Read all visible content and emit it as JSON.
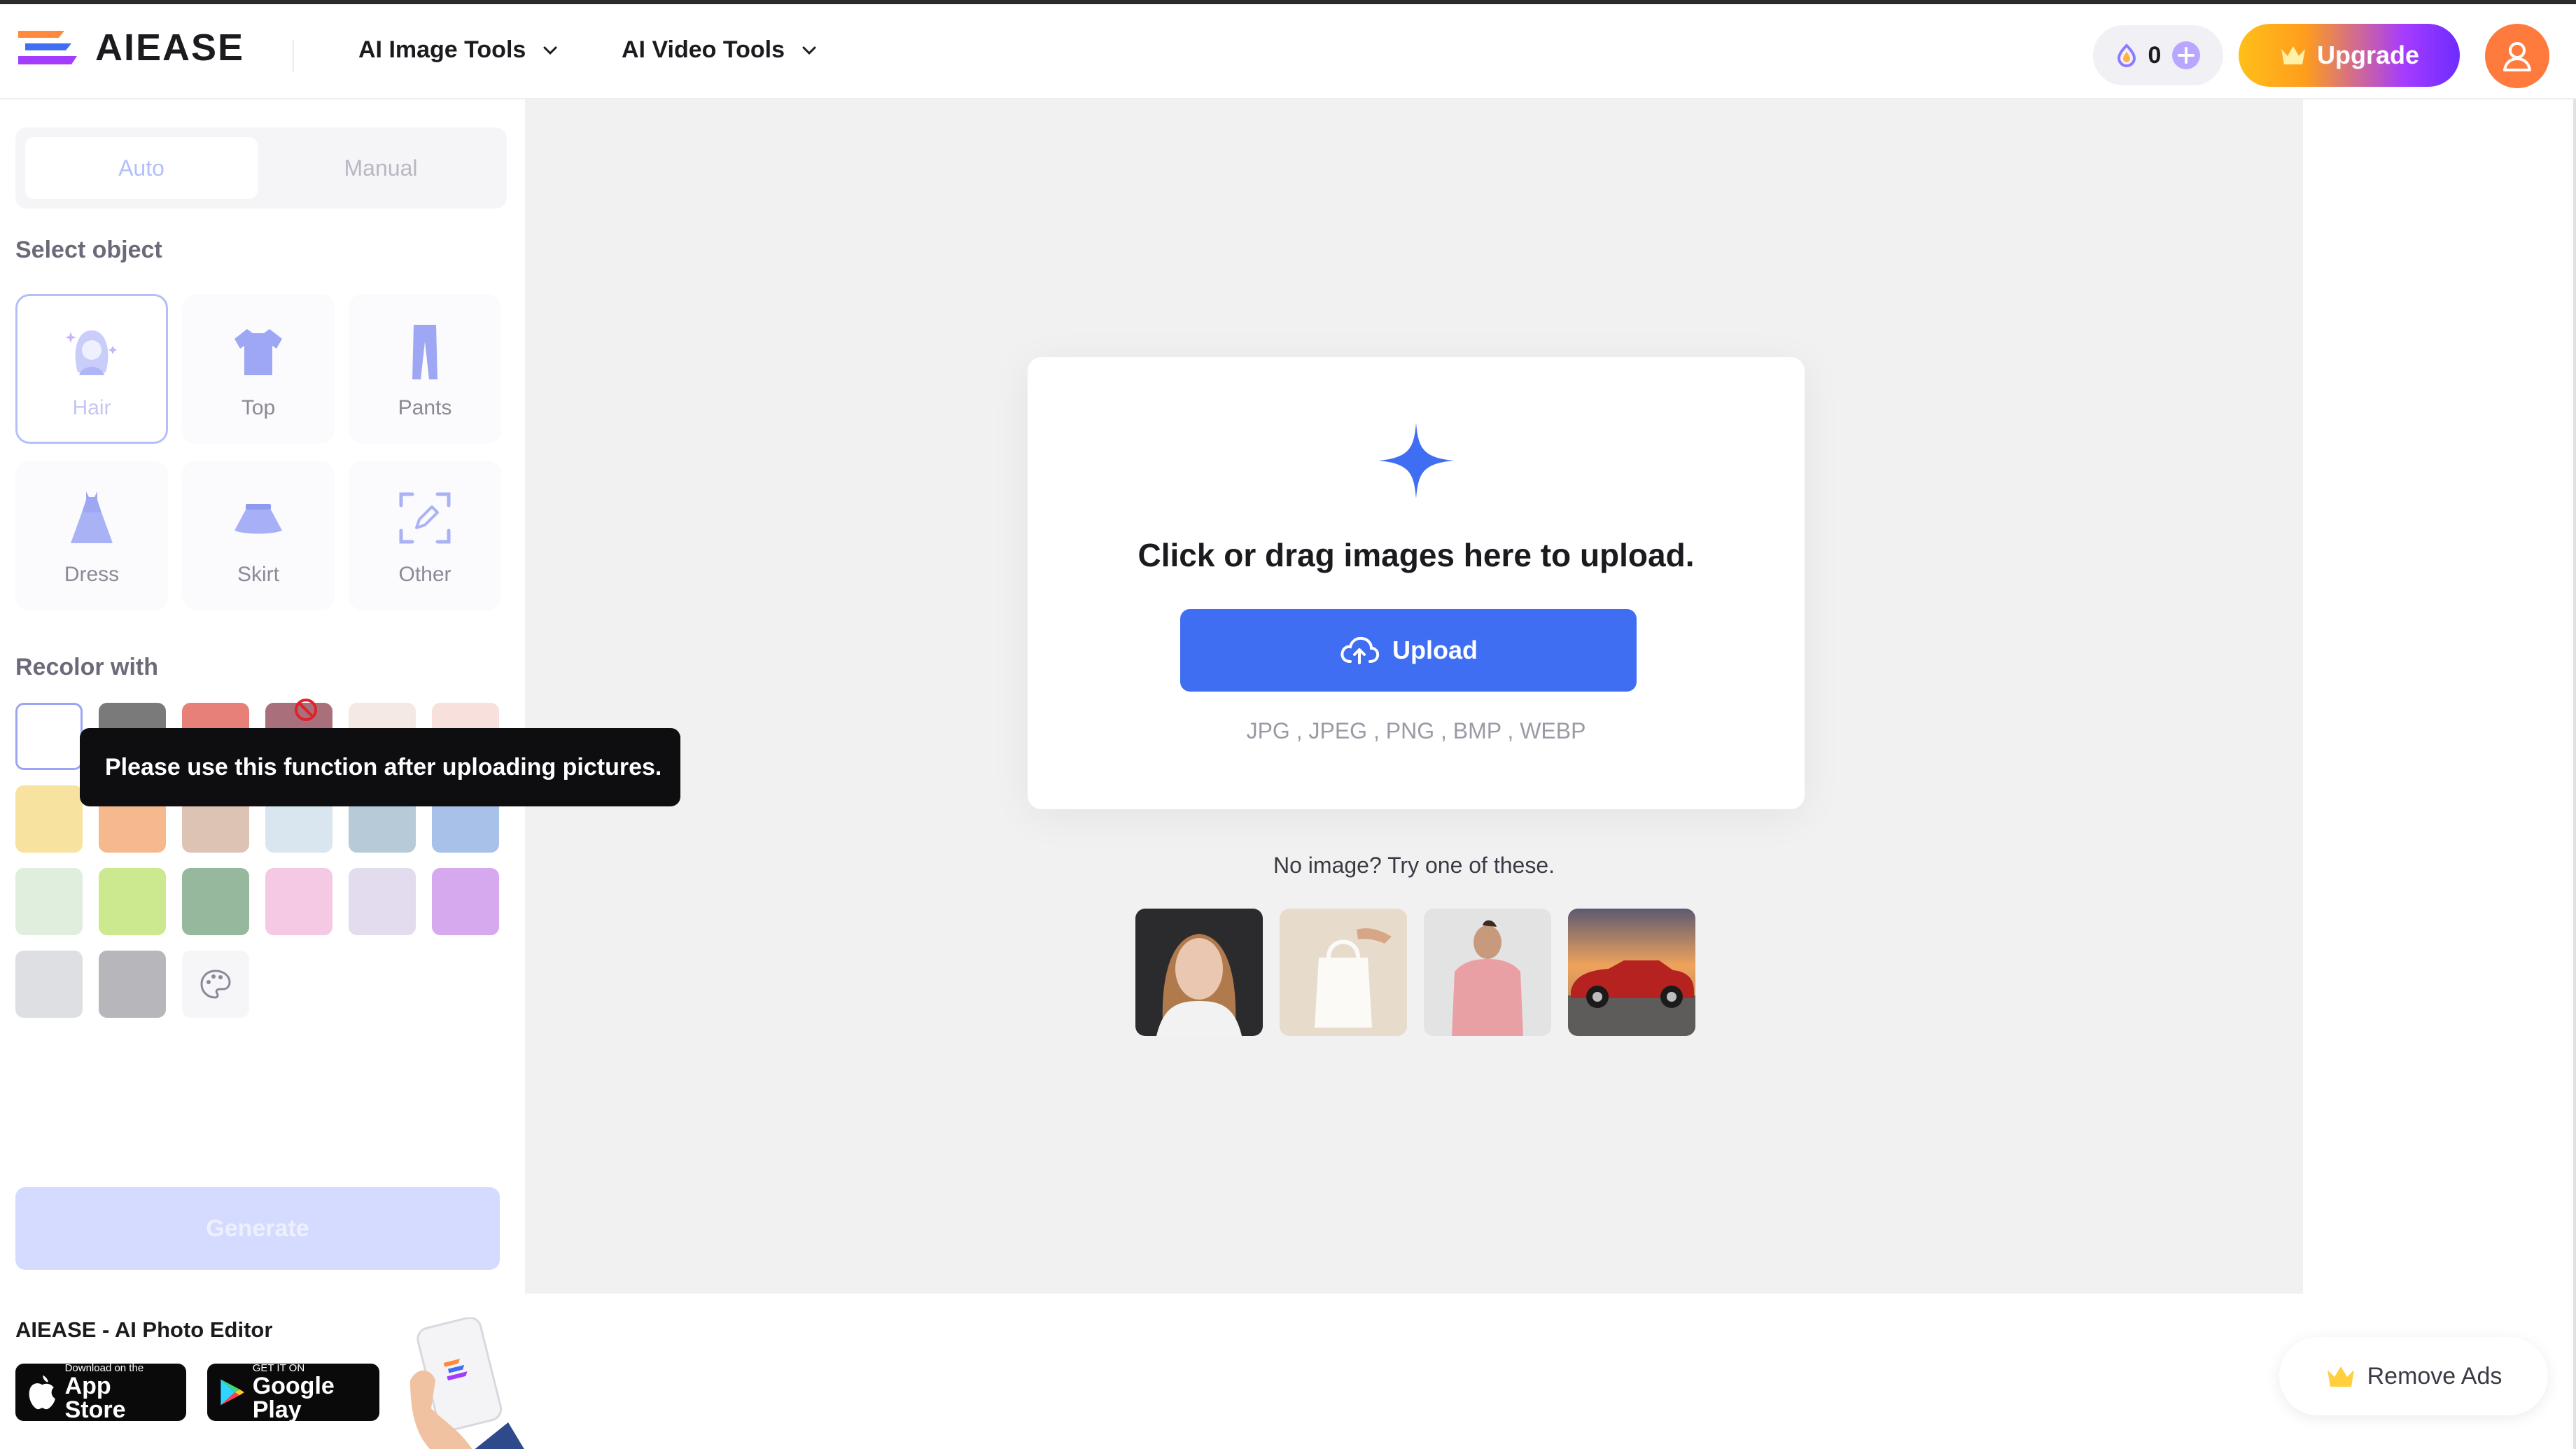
{
  "header": {
    "brand": "AIEASE",
    "menus": [
      {
        "label": "AI Image Tools"
      },
      {
        "label": "AI Video Tools"
      }
    ],
    "credits": "0",
    "upgrade_label": "Upgrade"
  },
  "sidebar": {
    "modes": [
      {
        "label": "Auto"
      },
      {
        "label": "Manual"
      }
    ],
    "select_object_label": "Select object",
    "objects": [
      {
        "label": "Hair",
        "icon": "hair-icon"
      },
      {
        "label": "Top",
        "icon": "shirt-icon"
      },
      {
        "label": "Pants",
        "icon": "pants-icon"
      },
      {
        "label": "Dress",
        "icon": "dress-icon"
      },
      {
        "label": "Skirt",
        "icon": "skirt-icon"
      },
      {
        "label": "Other",
        "icon": "edit-frame-icon"
      }
    ],
    "recolor_label": "Recolor with",
    "swatches": [
      "#ffffff",
      "#7a7a7a",
      "#e8807a",
      "#a9707c",
      "#f4eae3",
      "#f8e0dd",
      "#f8e2a0",
      "#f5b98d",
      "#dcc3b4",
      "#d9e6ef",
      "#b6cad8",
      "#a7c1e8",
      "#dfeedd",
      "#cde98f",
      "#96b89d",
      "#f5c8e3",
      "#e3dbee",
      "#d6a9ef",
      "#dedfe3",
      "#b7b7bb"
    ],
    "tooltip": "Please use this function after uploading pictures.",
    "generate_label": "Generate",
    "app_title": "AIEASE - AI Photo Editor",
    "app_store": {
      "small": "Download on the",
      "big": "App Store"
    },
    "google_play": {
      "small": "GET IT ON",
      "big": "Google Play"
    }
  },
  "main": {
    "upload_title": "Click or drag images here to upload.",
    "upload_label": "Upload",
    "formats": "JPG , JPEG , PNG , BMP , WEBP",
    "try_label": "No image? Try one of these.",
    "samples": [
      {
        "name": "sample-portrait-woman"
      },
      {
        "name": "sample-tote-bag"
      },
      {
        "name": "sample-man-pink-shirt"
      },
      {
        "name": "sample-red-car"
      }
    ],
    "remove_ads_label": "Remove Ads"
  },
  "colors": {
    "accent": "#3f6ef2",
    "selected_border": "#b4bffa",
    "generate_disabled": "#d5dbff",
    "tooltip_bg": "#0e0e10"
  }
}
